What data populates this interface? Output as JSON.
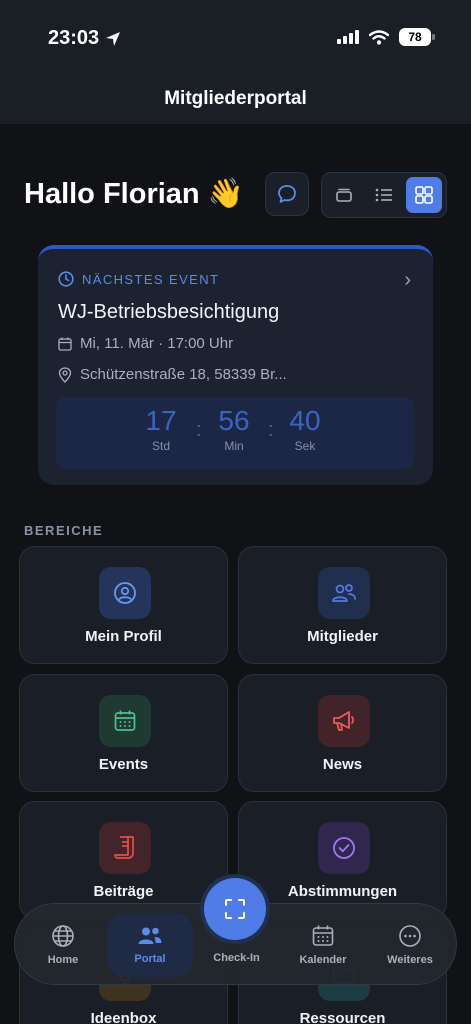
{
  "status_bar": {
    "time": "23:03",
    "battery": "78"
  },
  "header": {
    "title": "Mitgliederportal"
  },
  "greeting": {
    "text": "Hallo Florian 👋"
  },
  "event": {
    "label": "NÄCHSTES EVENT",
    "title": "WJ-Betriebsbesichtigung",
    "date": "Mi, 11. Mär · 17:00 Uhr",
    "location": "Schützenstraße 18, 58339 Br...",
    "countdown": [
      {
        "value": "17",
        "unit": "Std"
      },
      {
        "value": "56",
        "unit": "Min"
      },
      {
        "value": "40",
        "unit": "Sek"
      }
    ]
  },
  "section": {
    "label": "BEREICHE"
  },
  "tiles": [
    {
      "label": "Mein Profil",
      "icon": "user-circle-icon",
      "color": "#4f7ce6"
    },
    {
      "label": "Mitglieder",
      "icon": "users-icon",
      "color": "#3f6ccf"
    },
    {
      "label": "Events",
      "icon": "calendar-icon",
      "color": "#3fa77c"
    },
    {
      "label": "News",
      "icon": "megaphone-icon",
      "color": "#e05050"
    },
    {
      "label": "Beiträge",
      "icon": "receipt-icon",
      "color": "#d9473f"
    },
    {
      "label": "Abstimmungen",
      "icon": "check-circle-icon",
      "color": "#9a6ae0"
    },
    {
      "label": "Ideenbox",
      "icon": "lightbulb-icon",
      "color": "#d9a23a"
    },
    {
      "label": "Ressourcen",
      "icon": "folder-icon",
      "color": "#37b3c4"
    }
  ],
  "tabbar": {
    "home": "Home",
    "portal": "Portal",
    "checkin": "Check-In",
    "kalender": "Kalender",
    "weiteres": "Weiteres"
  },
  "colors": {
    "accent": "#4f7ce6",
    "background": "#101216",
    "card": "#1a1e26"
  }
}
